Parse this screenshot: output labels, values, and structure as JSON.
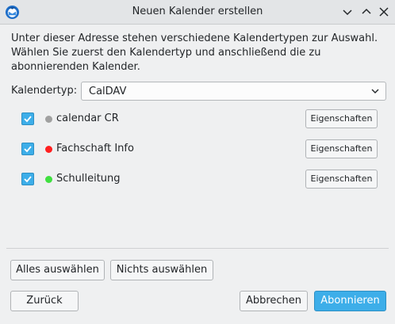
{
  "window": {
    "title": "Neuen Kalender erstellen"
  },
  "description": "Unter dieser Adresse stehen verschiedene Kalendertypen zur Auswahl. Wählen Sie zuerst den Kalendertyp und anschließend die zu abonnierenden Kalender.",
  "calendar_type": {
    "label": "Kalendertyp:",
    "value": "CalDAV"
  },
  "calendars": [
    {
      "name": "calendar CR",
      "color": "#a0a0a0",
      "checked": true,
      "button": "Eigenschaften"
    },
    {
      "name": "Fachschaft Info",
      "color": "#ff2020",
      "checked": true,
      "button": "Eigenschaften"
    },
    {
      "name": "Schulleitung",
      "color": "#40e040",
      "checked": true,
      "button": "Eigenschaften"
    }
  ],
  "selection": {
    "select_all": "Alles auswählen",
    "select_none": "Nichts auswählen"
  },
  "footer": {
    "back": "Zurück",
    "cancel": "Abbrechen",
    "subscribe": "Abonnieren"
  },
  "colors": {
    "accent": "#3daee9",
    "background": "#eff0f1"
  },
  "icons": {
    "app": "thunderbird-icon",
    "minimize": "chevron-down-icon",
    "maximize": "chevron-up-icon",
    "close": "close-icon"
  }
}
